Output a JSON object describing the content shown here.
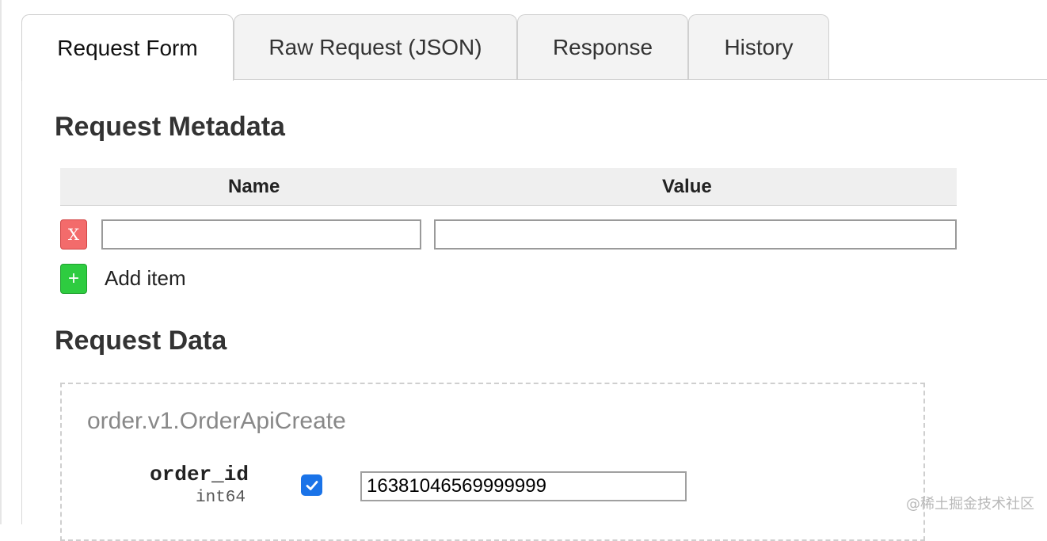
{
  "tabs": [
    {
      "label": "Request Form",
      "active": true
    },
    {
      "label": "Raw Request (JSON)",
      "active": false
    },
    {
      "label": "Response",
      "active": false
    },
    {
      "label": "History",
      "active": false
    }
  ],
  "metadata": {
    "heading": "Request Metadata",
    "columns": [
      "Name",
      "Value"
    ],
    "rows": [
      {
        "name": "",
        "value": "",
        "delete_label": "X"
      }
    ],
    "add_button_label": "+",
    "add_label": "Add item"
  },
  "request_data": {
    "heading": "Request Data",
    "message_type": "order.v1.OrderApiCreate",
    "fields": [
      {
        "name": "order_id",
        "type": "int64",
        "checked": true,
        "value": "16381046569999999"
      }
    ]
  },
  "watermark": "@稀土掘金技术社区",
  "colors": {
    "delete": "#f36b6b",
    "add": "#2ecc40",
    "checkbox": "#1a73e8"
  }
}
